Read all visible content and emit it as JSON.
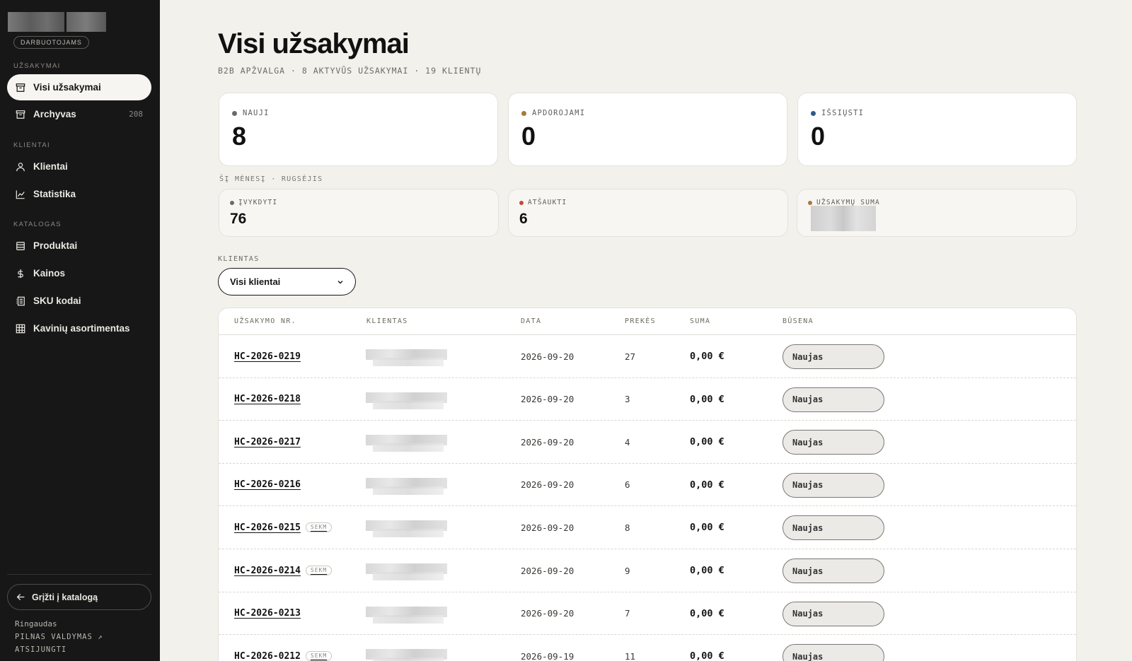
{
  "sidebar": {
    "badge": "DARBUOTOJAMS",
    "sections": {
      "orders": "UŽSAKYMAI",
      "clients": "KLIENTAI",
      "catalog": "KATALOGAS"
    },
    "items": {
      "all_orders": "Visi užsakymai",
      "archive": "Archyvas",
      "archive_count": "208",
      "clients": "Klientai",
      "statistics": "Statistika",
      "products": "Produktai",
      "prices": "Kainos",
      "sku": "SKU kodai",
      "assortment": "Kavinių asortimentas"
    },
    "back_button": "Grįžti į katalogą",
    "footer": {
      "user": "Ringaudas",
      "full_admin": "PILNAS VALDYMAS ↗",
      "logout": "ATSIJUNGTI"
    }
  },
  "header": {
    "title": "Visi užsakymai",
    "subtitle": "B2B APŽVALGA · 8 AKTYVŪS UŽSAKYMAI · 19 KLIENTŲ"
  },
  "stats": {
    "new_label": "NAUJI",
    "new_value": "8",
    "processing_label": "APDOROJAMI",
    "processing_value": "0",
    "shipped_label": "IŠSIŲSTI",
    "shipped_value": "0"
  },
  "month": {
    "label": "ŠĮ MĖNESĮ · RUGSĖJIS",
    "completed_label": "ĮVYKDYTI",
    "completed_value": "76",
    "cancelled_label": "ATŠAUKTI",
    "cancelled_value": "6",
    "sum_label": "UŽSAKYMŲ SUMA"
  },
  "filter": {
    "label": "KLIENTAS",
    "selected": "Visi klientai"
  },
  "table": {
    "headers": {
      "order_no": "UŽSAKYMO NR.",
      "client": "KLIENTAS",
      "date": "DATA",
      "items": "PREKĖS",
      "sum": "SUMA",
      "status": "BŪSENA"
    },
    "rows": [
      {
        "no": "HC-2026-0219",
        "tag": "",
        "date": "2026-09-20",
        "qty": "27",
        "sum": "0,00 €",
        "status": "Naujas"
      },
      {
        "no": "HC-2026-0218",
        "tag": "",
        "date": "2026-09-20",
        "qty": "3",
        "sum": "0,00 €",
        "status": "Naujas"
      },
      {
        "no": "HC-2026-0217",
        "tag": "",
        "date": "2026-09-20",
        "qty": "4",
        "sum": "0,00 €",
        "status": "Naujas"
      },
      {
        "no": "HC-2026-0216",
        "tag": "",
        "date": "2026-09-20",
        "qty": "6",
        "sum": "0,00 €",
        "status": "Naujas"
      },
      {
        "no": "HC-2026-0215",
        "tag": "SEKM",
        "date": "2026-09-20",
        "qty": "8",
        "sum": "0,00 €",
        "status": "Naujas"
      },
      {
        "no": "HC-2026-0214",
        "tag": "SEKM",
        "date": "2026-09-20",
        "qty": "9",
        "sum": "0,00 €",
        "status": "Naujas"
      },
      {
        "no": "HC-2026-0213",
        "tag": "",
        "date": "2026-09-20",
        "qty": "7",
        "sum": "0,00 €",
        "status": "Naujas"
      },
      {
        "no": "HC-2026-0212",
        "tag": "SEKM",
        "date": "2026-09-19",
        "qty": "11",
        "sum": "0,00 €",
        "status": "Naujas"
      }
    ]
  },
  "colors": {
    "new_dot": "#6b6a66",
    "processing_dot": "#a57a3c",
    "shipped_dot": "#2f5a8a",
    "completed_dot": "#6b6a66",
    "cancelled_dot": "#c44a3a",
    "sum_dot": "#a57a3c"
  }
}
